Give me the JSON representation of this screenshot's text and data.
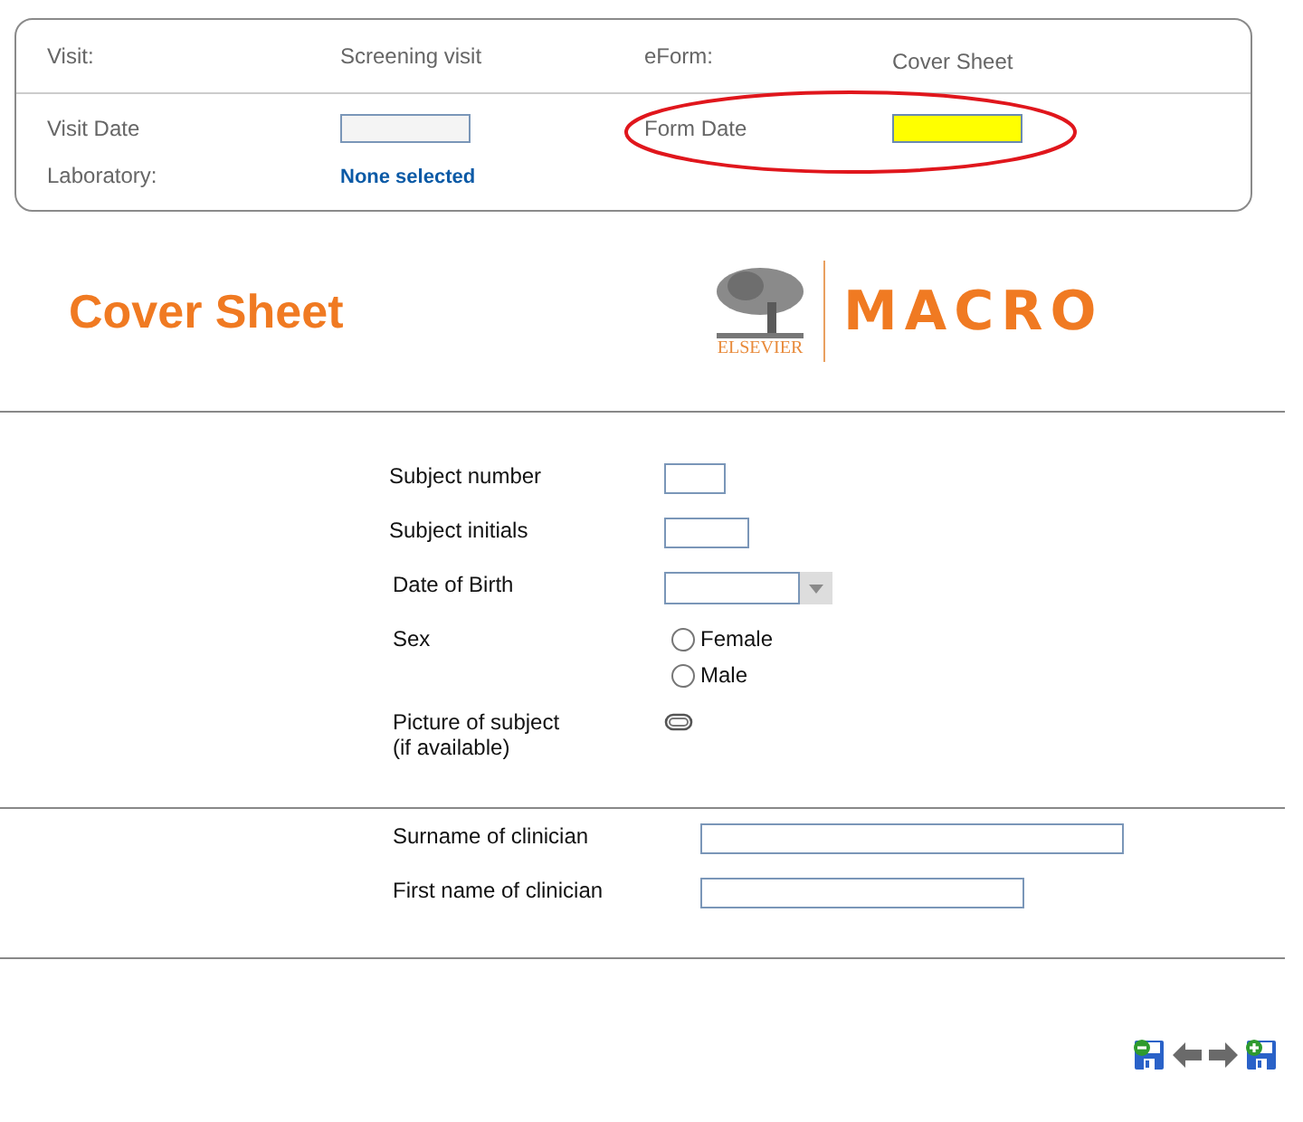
{
  "header": {
    "rows": [
      {
        "label_1": "Visit:",
        "value_1": "Screening visit",
        "label_2": "eForm:",
        "value_2": "Cover Sheet"
      },
      {
        "label_1": "Visit Date",
        "field_1": {
          "focused": false
        },
        "label_2": "Form Date",
        "field_2": {
          "focused": true
        }
      },
      {
        "label_1": "Laboratory:",
        "link_1": "None selected"
      }
    ]
  },
  "title": "Cover Sheet",
  "logo": {
    "publisher": "ELSEVIER",
    "product": "MACRO"
  },
  "sections": [
    {
      "questions": [
        {
          "label": "Subject number",
          "kind": "text"
        },
        {
          "label": "Subject initials",
          "kind": "text"
        },
        {
          "label": "Date of Birth",
          "kind": "date"
        },
        {
          "label": "Sex",
          "kind": "radio",
          "options": [
            {
              "label": "Female",
              "selected": false
            },
            {
              "label": "Male",
              "selected": false
            }
          ]
        },
        {
          "label": "Picture of subject\n(if available)",
          "kind": "attachment"
        }
      ]
    },
    {
      "questions": [
        {
          "label": "Surname of clinician",
          "kind": "text"
        },
        {
          "label": "First name of clinician",
          "kind": "text"
        }
      ]
    }
  ]
}
